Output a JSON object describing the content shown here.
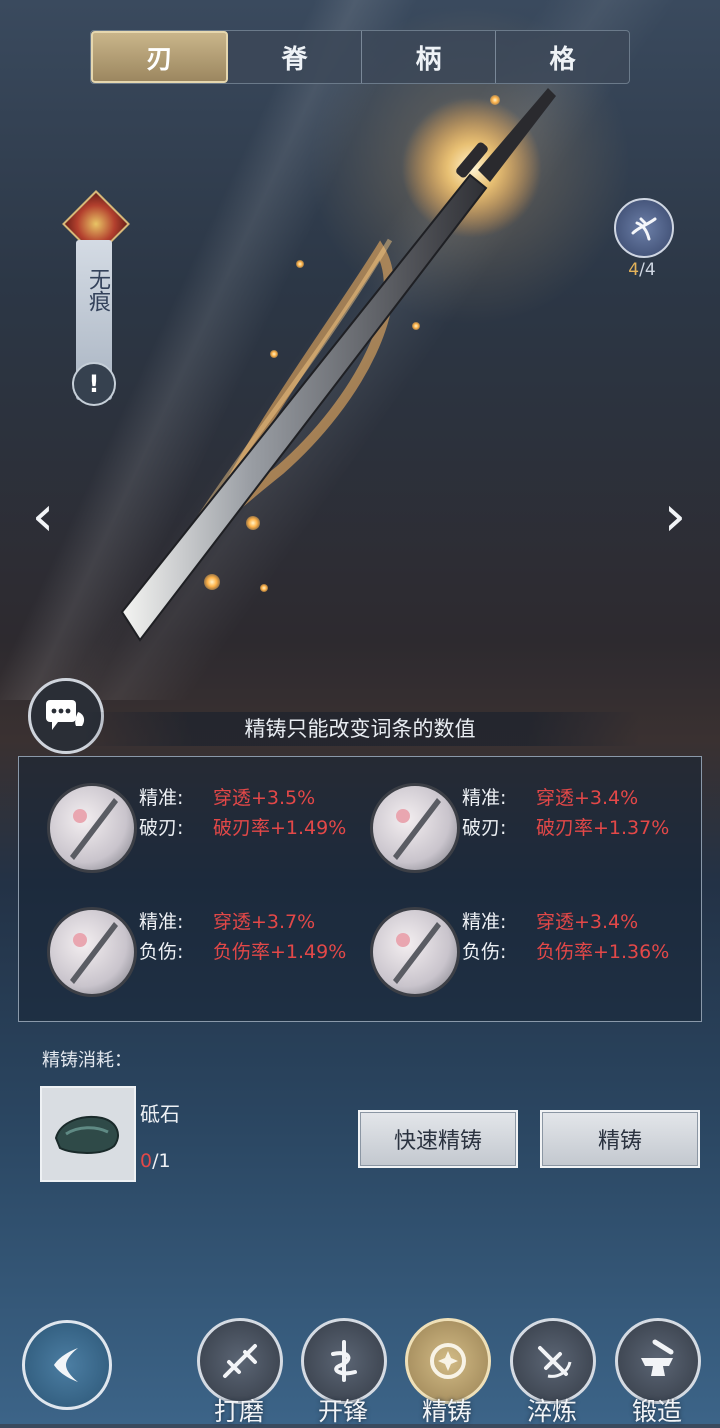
{
  "tabs": [
    {
      "label": "刃",
      "active": true
    },
    {
      "label": "脊",
      "active": false
    },
    {
      "label": "柄",
      "active": false
    },
    {
      "label": "格",
      "active": false
    }
  ],
  "weapon": {
    "name": "无痕",
    "badge_current": "4",
    "badge_sep": "/",
    "badge_total": "4"
  },
  "nav_arrows": {
    "left": "‹",
    "right": "›"
  },
  "hint": "精铸只能改变词条的数值",
  "stat_options": [
    {
      "line1_label": "精准:",
      "line1_value": "穿透+3.5%",
      "line2_label": "破刃:",
      "line2_value": "破刃率+1.49%"
    },
    {
      "line1_label": "精准:",
      "line1_value": "穿透+3.4%",
      "line2_label": "破刃:",
      "line2_value": "破刃率+1.37%"
    },
    {
      "line1_label": "精准:",
      "line1_value": "穿透+3.7%",
      "line2_label": "负伤:",
      "line2_value": "负伤率+1.49%"
    },
    {
      "line1_label": "精准:",
      "line1_value": "穿透+3.4%",
      "line2_label": "负伤:",
      "line2_value": "负伤率+1.36%"
    }
  ],
  "cost": {
    "label": "精铸消耗：",
    "material_name": "砥石",
    "have": "0",
    "need": "/1"
  },
  "buttons": {
    "quick_forge": "快速精铸",
    "forge": "精铸"
  },
  "bottom_nav": [
    {
      "label": "打磨",
      "icon": "grind-icon",
      "active": false
    },
    {
      "label": "开锋",
      "icon": "sharpen-icon",
      "active": false
    },
    {
      "label": "精铸",
      "icon": "refine-icon",
      "active": true
    },
    {
      "label": "淬炼",
      "icon": "temper-icon",
      "active": false
    },
    {
      "label": "锻造",
      "icon": "anvil-icon",
      "active": false
    }
  ],
  "colors": {
    "accent_gold": "#c9b58a",
    "stat_red": "#e34848"
  }
}
